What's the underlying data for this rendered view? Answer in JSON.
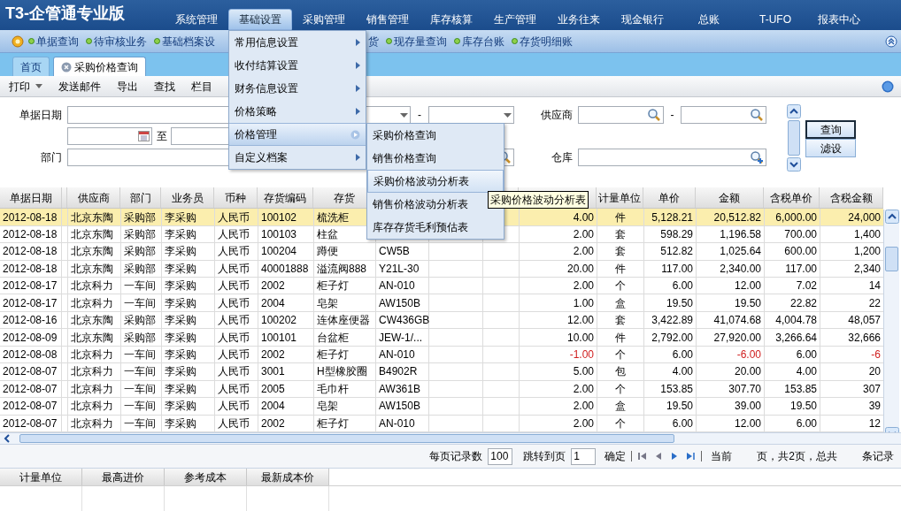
{
  "app": {
    "logo": "T3-企管通专业版"
  },
  "main_menu": [
    {
      "label": "系统管理",
      "selected": false
    },
    {
      "label": "基础设置",
      "selected": true
    },
    {
      "label": "采购管理",
      "selected": false
    },
    {
      "label": "销售管理",
      "selected": false
    },
    {
      "label": "库存核算",
      "selected": false
    },
    {
      "label": "生产管理",
      "selected": false
    },
    {
      "label": "业务往来",
      "selected": false
    },
    {
      "label": "现金银行",
      "selected": false
    },
    {
      "label": "总账",
      "selected": false
    },
    {
      "label": "T-UFO",
      "selected": false
    },
    {
      "label": "报表中心",
      "selected": false
    }
  ],
  "quick_links": {
    "left": [
      {
        "label": "单据查询",
        "dot": true
      },
      {
        "label": "待审核业务",
        "dot": true
      },
      {
        "label": "基础档案设",
        "dot": true
      }
    ],
    "right": [
      {
        "label": "货",
        "dot": false
      },
      {
        "label": "现存量查询",
        "dot": true
      },
      {
        "label": "库存台账",
        "dot": true
      },
      {
        "label": "存货明细账",
        "dot": true
      }
    ]
  },
  "tabs": [
    {
      "label": "首页",
      "selected": false,
      "closable": false
    },
    {
      "label": "采购价格查询",
      "selected": true,
      "closable": true
    }
  ],
  "toolbar": [
    {
      "label": "打印",
      "dropdown": true
    },
    {
      "label": "发送邮件",
      "dropdown": false
    },
    {
      "label": "导出",
      "dropdown": false
    },
    {
      "label": "查找",
      "dropdown": false
    },
    {
      "label": "栏目",
      "dropdown": false
    }
  ],
  "filter": {
    "date_label": "单据日期",
    "to_label": "至",
    "dept_label": "部门",
    "supplier_label": "供应商",
    "supplier_dash": "-",
    "range_dash": "-",
    "warehouse_label": "仓库",
    "buttons": [
      {
        "label": "查询",
        "selected": true
      },
      {
        "label": "滤设",
        "selected": false
      }
    ]
  },
  "dropdown_menu": [
    {
      "label": "常用信息设置",
      "selected": false
    },
    {
      "label": "收付结算设置",
      "selected": false
    },
    {
      "label": "财务信息设置",
      "selected": false
    },
    {
      "label": "价格策略",
      "selected": false
    },
    {
      "label": "价格管理",
      "selected": true
    },
    {
      "label": "自定义档案",
      "selected": false
    }
  ],
  "submenu": [
    {
      "label": "采购价格查询",
      "hovered": false
    },
    {
      "label": "销售价格查询",
      "hovered": false
    },
    {
      "label": "采购价格波动分析表",
      "hovered": true
    },
    {
      "label": "销售价格波动分析表",
      "hovered": false
    },
    {
      "label": "库存存货毛利预估表",
      "hovered": false
    }
  ],
  "tooltip": "采购价格波动分析表",
  "table": {
    "columns": [
      "单据日期",
      null,
      "供应商",
      "部门",
      "业务员",
      "币种",
      "存货编码",
      "存货",
      null,
      null,
      null,
      null,
      "计量单位",
      "单价",
      "金额",
      "含税单价",
      "含税金额"
    ],
    "rows": [
      {
        "selected": true,
        "negative": false,
        "cells": [
          "2012-08-18",
          null,
          "北京东陶",
          "采购部",
          "李采购",
          "人民币",
          "100102",
          "梳洗柜",
          null,
          null,
          null,
          "4.00",
          "件",
          "5,128.21",
          "20,512.82",
          "6,000.00",
          "24,000"
        ]
      },
      {
        "selected": false,
        "negative": false,
        "cells": [
          "2012-08-18",
          null,
          "北京东陶",
          "采购部",
          "李采购",
          "人民币",
          "100103",
          "柱盆",
          null,
          null,
          null,
          "2.00",
          "套",
          "598.29",
          "1,196.58",
          "700.00",
          "1,400"
        ]
      },
      {
        "selected": false,
        "negative": false,
        "cells": [
          "2012-08-18",
          null,
          "北京东陶",
          "采购部",
          "李采购",
          "人民币",
          "100204",
          "蹲便",
          "CW5B",
          null,
          null,
          "2.00",
          "套",
          "512.82",
          "1,025.64",
          "600.00",
          "1,200"
        ]
      },
      {
        "selected": false,
        "negative": false,
        "cells": [
          "2012-08-18",
          null,
          "北京东陶",
          "采购部",
          "李采购",
          "人民币",
          "40001888",
          "溢流阀888",
          "Y21L-30",
          null,
          null,
          "20.00",
          "件",
          "117.00",
          "2,340.00",
          "117.00",
          "2,340"
        ]
      },
      {
        "selected": false,
        "negative": false,
        "cells": [
          "2012-08-17",
          null,
          "北京科力",
          "一车间",
          "李采购",
          "人民币",
          "2002",
          "柜子灯",
          "AN-010",
          null,
          null,
          "2.00",
          "个",
          "6.00",
          "12.00",
          "7.02",
          "14"
        ]
      },
      {
        "selected": false,
        "negative": false,
        "cells": [
          "2012-08-17",
          null,
          "北京科力",
          "一车间",
          "李采购",
          "人民币",
          "2004",
          "皂架",
          "AW150B",
          null,
          null,
          "1.00",
          "盒",
          "19.50",
          "19.50",
          "22.82",
          "22"
        ]
      },
      {
        "selected": false,
        "negative": false,
        "cells": [
          "2012-08-16",
          null,
          "北京东陶",
          "采购部",
          "李采购",
          "人民币",
          "100202",
          "连体座便器",
          "CW436GB",
          null,
          null,
          "12.00",
          "套",
          "3,422.89",
          "41,074.68",
          "4,004.78",
          "48,057"
        ]
      },
      {
        "selected": false,
        "negative": false,
        "cells": [
          "2012-08-09",
          null,
          "北京东陶",
          "采购部",
          "李采购",
          "人民币",
          "100101",
          "台盆柜",
          "JEW-1/...",
          null,
          null,
          "10.00",
          "件",
          "2,792.00",
          "27,920.00",
          "3,266.64",
          "32,666"
        ]
      },
      {
        "selected": false,
        "negative": true,
        "cells": [
          "2012-08-08",
          null,
          "北京科力",
          "一车间",
          "李采购",
          "人民币",
          "2002",
          "柜子灯",
          "AN-010",
          null,
          null,
          "-1.00",
          "个",
          "6.00",
          "-6.00",
          "6.00",
          "-6"
        ]
      },
      {
        "selected": false,
        "negative": false,
        "cells": [
          "2012-08-07",
          null,
          "北京科力",
          "一车间",
          "李采购",
          "人民币",
          "3001",
          "H型橡胶圈",
          "B4902R",
          null,
          null,
          "5.00",
          "包",
          "4.00",
          "20.00",
          "4.00",
          "20"
        ]
      },
      {
        "selected": false,
        "negative": false,
        "cells": [
          "2012-08-07",
          null,
          "北京科力",
          "一车间",
          "李采购",
          "人民币",
          "2005",
          "毛巾杆",
          "AW361B",
          null,
          null,
          "2.00",
          "个",
          "153.85",
          "307.70",
          "153.85",
          "307"
        ]
      },
      {
        "selected": false,
        "negative": false,
        "cells": [
          "2012-08-07",
          null,
          "北京科力",
          "一车间",
          "李采购",
          "人民币",
          "2004",
          "皂架",
          "AW150B",
          null,
          null,
          "2.00",
          "盒",
          "19.50",
          "39.00",
          "19.50",
          "39"
        ]
      },
      {
        "selected": false,
        "negative": false,
        "cells": [
          "2012-08-07",
          null,
          "北京科力",
          "一车间",
          "李采购",
          "人民币",
          "2002",
          "柜子灯",
          "AN-010",
          null,
          null,
          "2.00",
          "个",
          "6.00",
          "12.00",
          "6.00",
          "12"
        ]
      }
    ]
  },
  "pager": {
    "page_size_label": "每页记录数",
    "page_size": "100",
    "jump_label": "跳转到页",
    "page": "1",
    "confirm": "确定",
    "status_parts": [
      "当前",
      "页，共2页，总共",
      "条记录"
    ]
  },
  "detail_table": {
    "columns": [
      "计量单位",
      "最高进价",
      "参考成本",
      "最新成本价"
    ]
  }
}
